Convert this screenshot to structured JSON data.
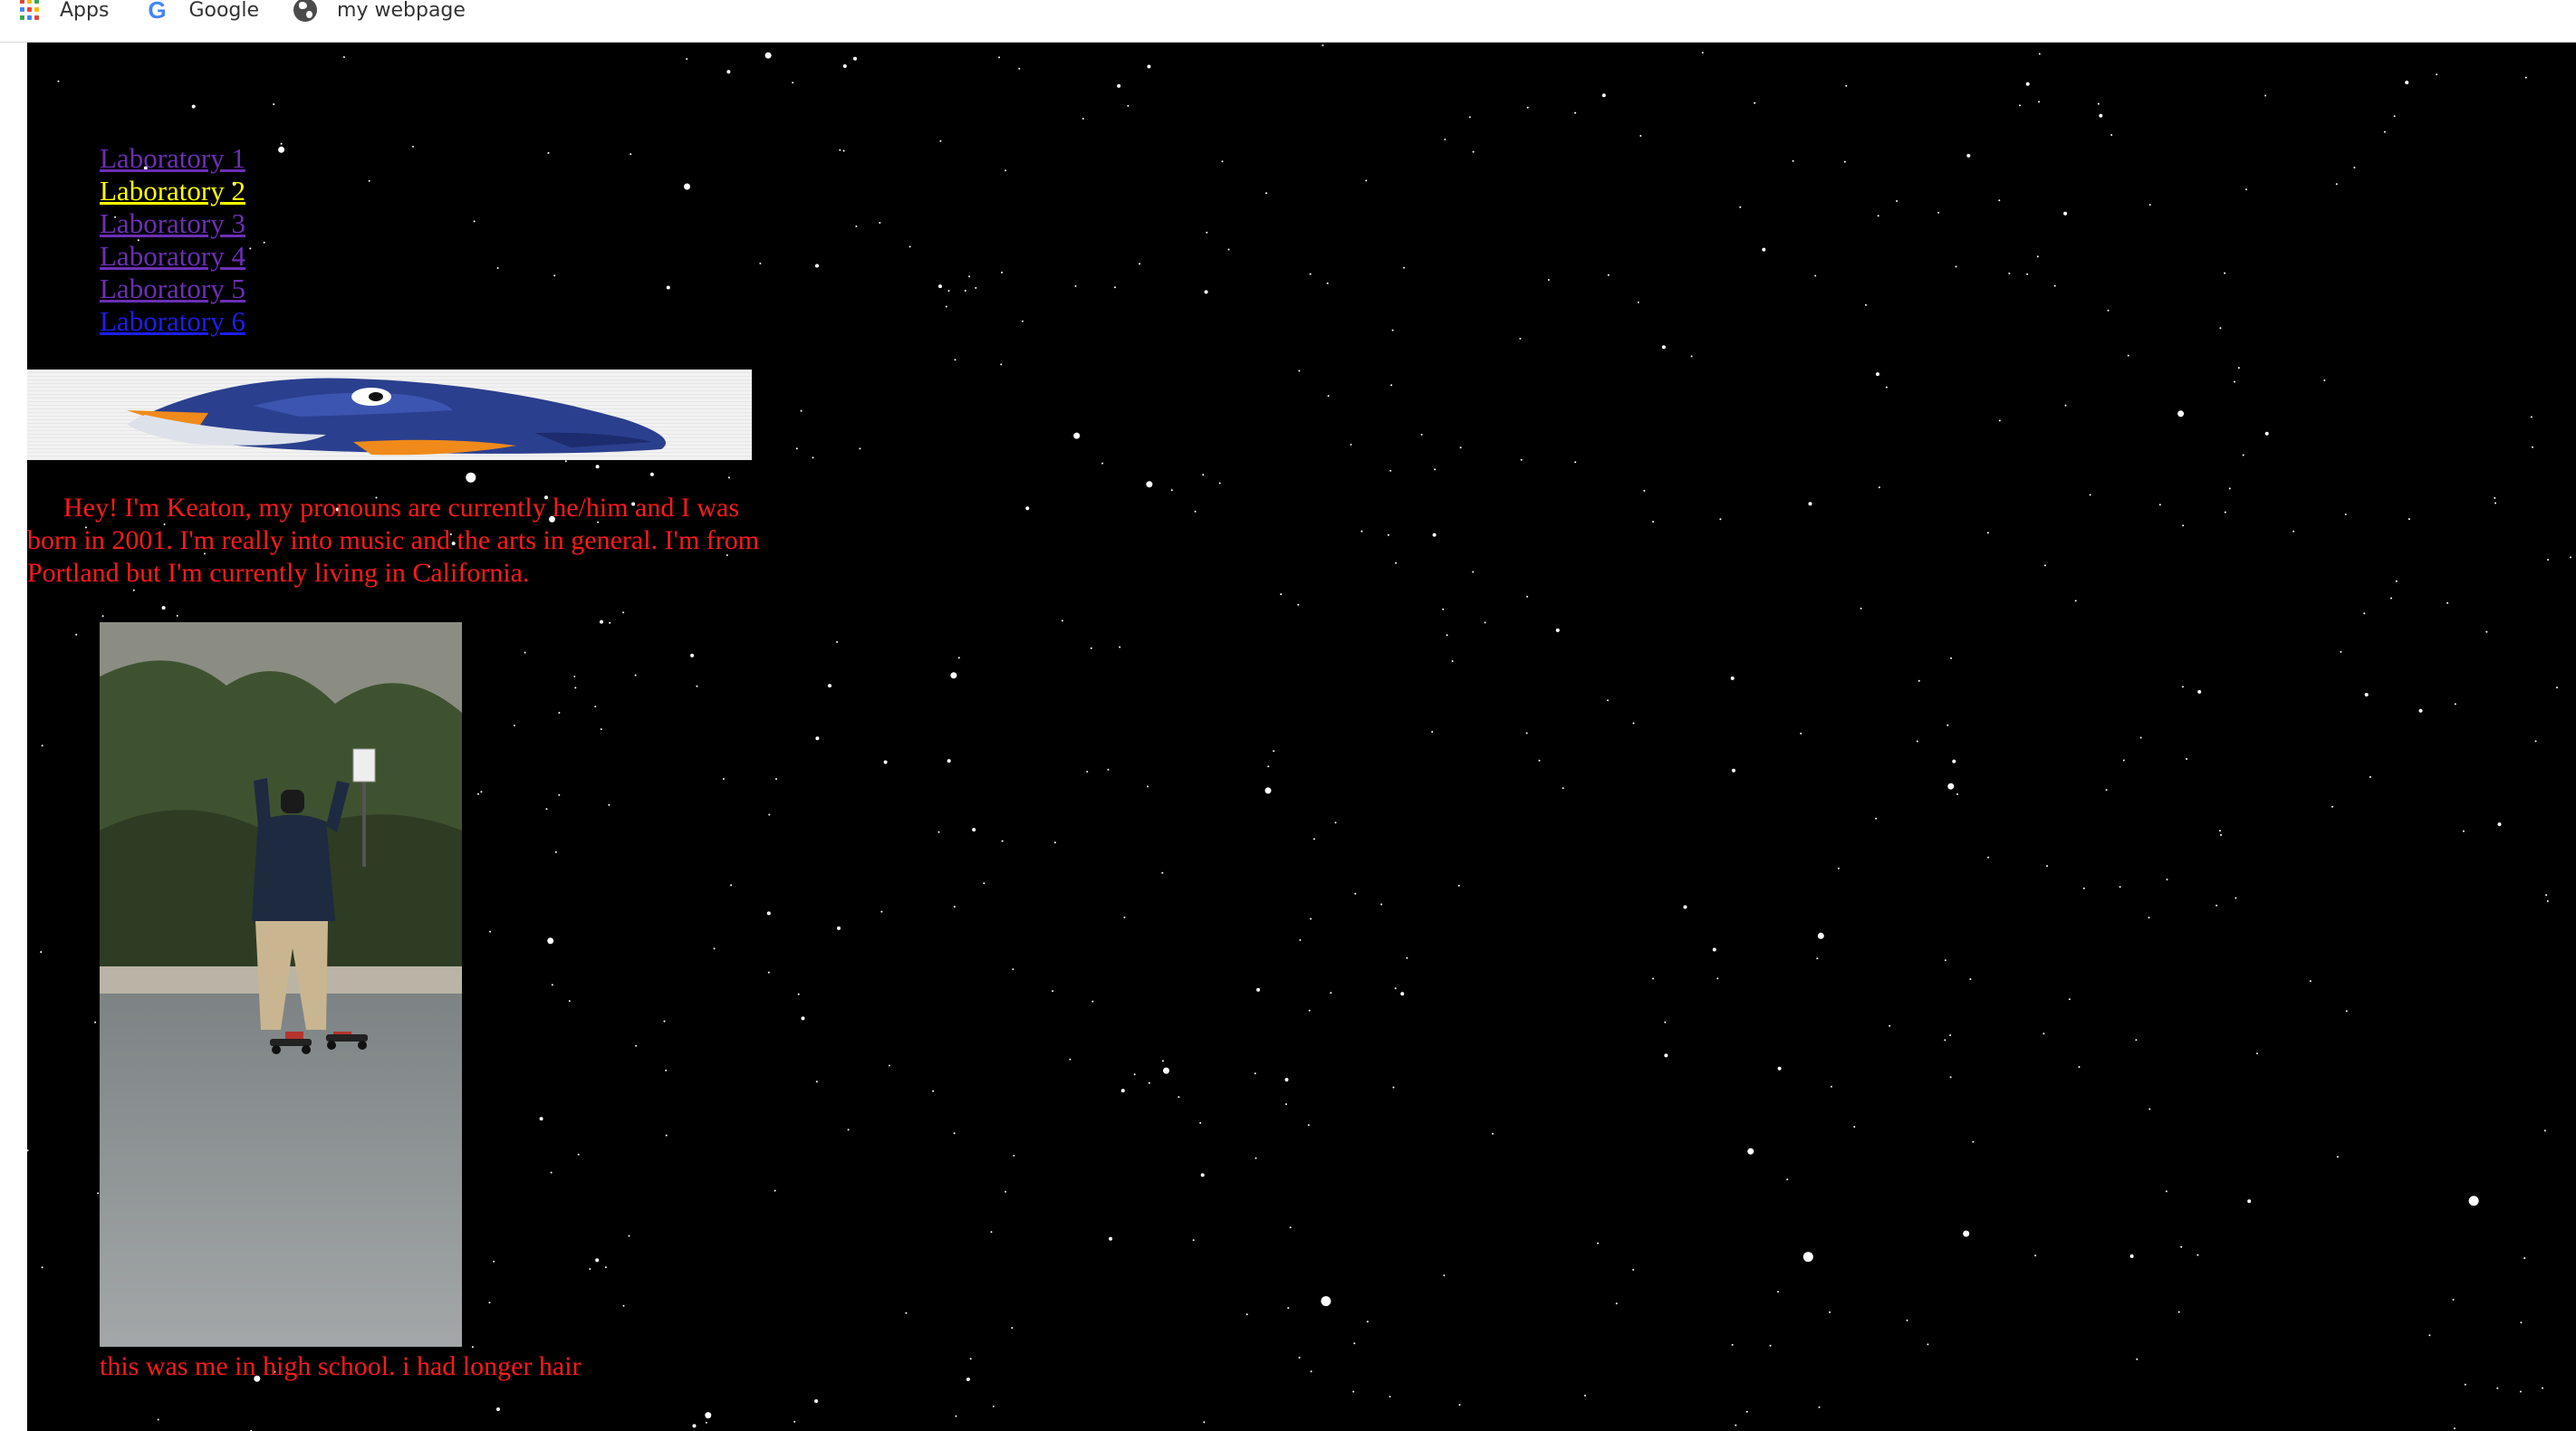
{
  "bookmarks_bar": {
    "items": [
      {
        "label": "Apps",
        "icon": "apps-grid-icon"
      },
      {
        "label": "Google",
        "icon": "google-g-icon"
      },
      {
        "label": "my webpage",
        "icon": "globe-icon"
      }
    ]
  },
  "page": {
    "background": "#000000",
    "nav_links": [
      {
        "label": "Laboratory 1",
        "state": "visited"
      },
      {
        "label": "Laboratory 2",
        "state": "active"
      },
      {
        "label": "Laboratory 3",
        "state": "visited"
      },
      {
        "label": "Laboratory 4",
        "state": "visited"
      },
      {
        "label": "Laboratory 5",
        "state": "visited"
      },
      {
        "label": "Laboratory 6",
        "state": "unvisited"
      }
    ],
    "intro_text": "Hey! I'm Keaton, my pronouns are currently he/him and I was born in 2001. I'm really into music and the arts in general. I'm from Portland but I'm currently living in California.",
    "photo_caption": "this was me in high school. i had longer hair",
    "colors": {
      "text": "#ff1a1a",
      "link_visited": "#6b2fb5",
      "link_active": "#ffff00",
      "link_unvisited": "#1d1df0",
      "stars": "#ffffff"
    }
  }
}
